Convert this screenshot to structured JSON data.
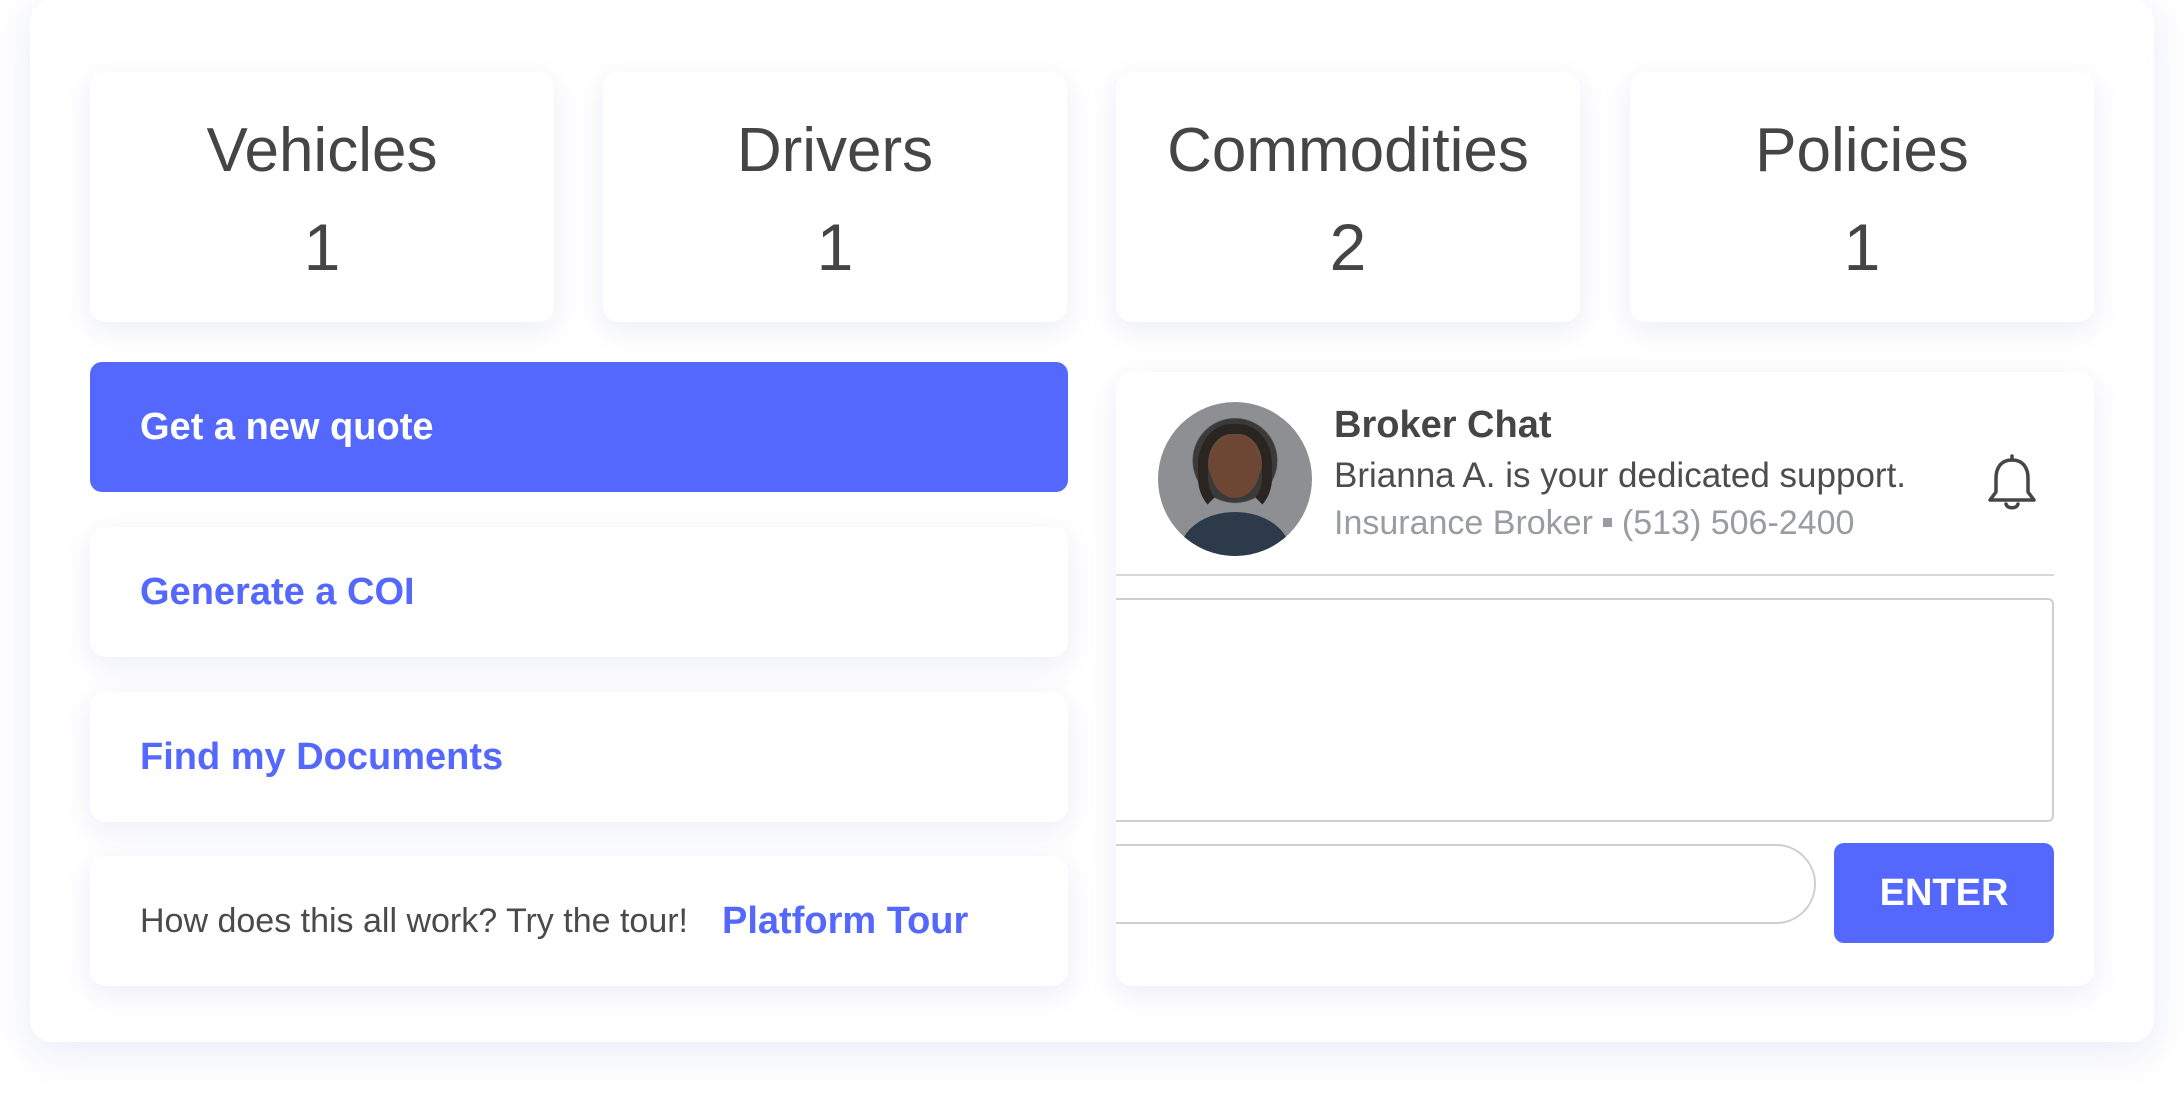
{
  "stats": [
    {
      "label": "Vehicles",
      "value": "1"
    },
    {
      "label": "Drivers",
      "value": "1"
    },
    {
      "label": "Commodities",
      "value": "2"
    },
    {
      "label": "Policies",
      "value": "1"
    }
  ],
  "actions": {
    "new_quote": "Get a new quote",
    "generate_coi": "Generate a COI",
    "find_documents": "Find my Documents"
  },
  "tour": {
    "prompt": "How does this all work? Try the tour!",
    "link": "Platform Tour"
  },
  "chat": {
    "title": "Broker Chat",
    "subtitle": "Brianna A. is your dedicated support.",
    "role": "Insurance Broker",
    "phone": "(513) 506-2400",
    "enter_label": "ENTER",
    "icon": "bell-icon"
  },
  "colors": {
    "accent": "#5468fe",
    "text": "#454545",
    "muted": "#9a9ca3"
  }
}
